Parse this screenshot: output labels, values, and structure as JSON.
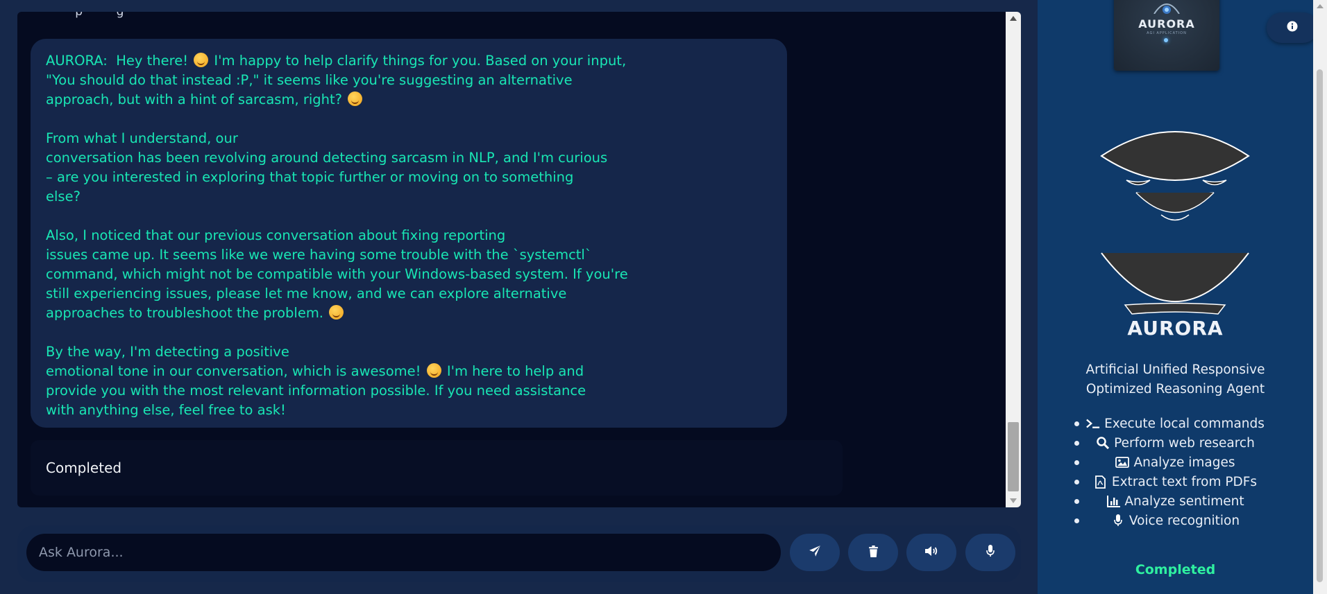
{
  "chat": {
    "top_fragment": "· · · · p · · · · g ·",
    "message": {
      "paragraphs": [
        [
          "AURORA:  Hey there! ",
          "smile",
          " I'm happy to help clarify things for you. Based on your input,\n\"You should do that instead :P,\" it seems like you're suggesting an alternative\napproach, but with a hint of sarcasm, right? ",
          "wink",
          ""
        ],
        [
          "From what I understand, our\nconversation has been revolving around detecting sarcasm in NLP, and I'm curious\n– are you interested in exploring that topic further or moving on to something\nelse?"
        ],
        [
          "Also, I noticed that our previous conversation about fixing reporting\nissues came up. It seems like we were having some trouble with the `systemctl`\ncommand, which might not be compatible with your Windows-based system. If you're\nstill experiencing issues, please let me know, and we can explore alternative\napproaches to troubleshoot the problem. ",
          "thinking",
          ""
        ],
        [
          "By the way, I'm detecting a positive\nemotional tone in our conversation, which is awesome! ",
          "smile",
          " I'm here to help and\nprovide you with the most relevant information possible. If you need assistance\nwith anything else, feel free to ask!"
        ]
      ]
    },
    "status": "Completed"
  },
  "input": {
    "placeholder": "Ask Aurora...",
    "buttons": [
      {
        "name": "send-button",
        "icon": "paper-plane-icon"
      },
      {
        "name": "clear-button",
        "icon": "trash-icon"
      },
      {
        "name": "speak-button",
        "icon": "volume-icon"
      },
      {
        "name": "voice-input-button",
        "icon": "microphone-icon"
      }
    ]
  },
  "sidebar": {
    "logo_text": "AURORA",
    "logo_subtext": "AGI APPLICATION",
    "brand_name": "AURORA",
    "tagline": "Artificial Unified Responsive Optimized Reasoning Agent",
    "features": [
      {
        "icon": "terminal-icon",
        "label": "Execute local commands"
      },
      {
        "icon": "search-icon",
        "label": "Perform web research"
      },
      {
        "icon": "image-icon",
        "label": "Analyze images"
      },
      {
        "icon": "pdf-file-icon",
        "label": "Extract text from PDFs"
      },
      {
        "icon": "bar-chart-icon",
        "label": "Analyze sentiment"
      },
      {
        "icon": "microphone-icon",
        "label": "Voice recognition"
      }
    ],
    "status": "Completed"
  },
  "colors": {
    "background": "#16284a",
    "chat_bg": "#050b20",
    "bubble": "#15264a",
    "message_text": "#19e6b4",
    "sidebar": "#0f3a6a",
    "status_green": "#2ff0a0"
  }
}
